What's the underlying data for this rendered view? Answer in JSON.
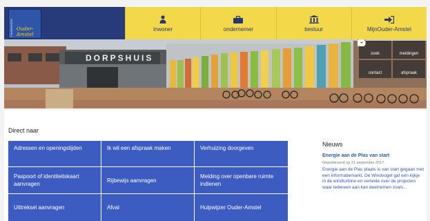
{
  "logo": {
    "vertical_text": "Gemeente",
    "line1": "Ouder-",
    "line2": "Amstel"
  },
  "nav": [
    {
      "label": "inwoner",
      "icon": "person-icon"
    },
    {
      "label": "ondernemer",
      "icon": "briefcase-icon"
    },
    {
      "label": "bestuur",
      "icon": "building-icon"
    },
    {
      "label": "MijnOuder-Amstel",
      "icon": "login-icon"
    }
  ],
  "hero": {
    "building_sign": "DORPSHUIS"
  },
  "quick": [
    {
      "label": "zoek",
      "icon": "search-icon"
    },
    {
      "label": "meldingen",
      "icon": "alert-icon"
    },
    {
      "label": "contact",
      "icon": "mail-icon"
    },
    {
      "label": "afspraak",
      "icon": "calendar-icon"
    }
  ],
  "direct": {
    "title": "Direct naar",
    "cells": [
      "Adressen en openingstijden",
      "Ik wil een afspraak maken",
      "Verhuizing doorgeven",
      "Paspoort of identiteitskaart aanvragen",
      "Rijbewijs aanvragen",
      "Melding over openbare ruimte indienen",
      "Uittreksel aanvragen",
      "Afval",
      "Hulpwijzer Ouder-Amstel"
    ]
  },
  "news": {
    "title": "Nieuws",
    "headline": "Energie aan de Plas van start",
    "date": "Gepubliceerd op 21 september 2017",
    "body": "Energie aan de Plas plaats is van start gegaan met een informatiemarkt. De Windvogel gaf een kijkje in de windturbine en vertelde over de projecten waar iedereen aan kan deelnemen zoals..."
  },
  "colors": {
    "brand_blue": "#273a7a",
    "nav_yellow": "#f3d84a",
    "cell_blue": "#3d5cc2",
    "link_blue": "#2f55bd"
  }
}
